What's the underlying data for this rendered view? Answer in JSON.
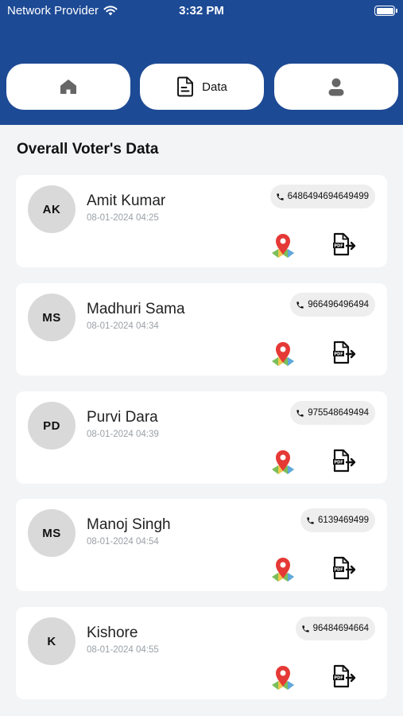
{
  "status_bar": {
    "carrier": "Network Provider",
    "time": "3:32 PM"
  },
  "tabs": [
    {
      "id": "home",
      "label": "",
      "icon": "home-icon"
    },
    {
      "id": "data",
      "label": "Data",
      "icon": "document-icon"
    },
    {
      "id": "profile",
      "label": "",
      "icon": "user-icon"
    }
  ],
  "section_title": "Overall Voter's Data",
  "voters": [
    {
      "initials": "AK",
      "name": "Amit Kumar",
      "datetime": "08-01-2024 04:25",
      "phone": "6486494694649499"
    },
    {
      "initials": "MS",
      "name": "Madhuri Sama",
      "datetime": "08-01-2024 04:34",
      "phone": "966496496494"
    },
    {
      "initials": "PD",
      "name": "Purvi Dara",
      "datetime": "08-01-2024 04:39",
      "phone": "975548649494"
    },
    {
      "initials": "MS",
      "name": "Manoj Singh",
      "datetime": "08-01-2024 04:54",
      "phone": "6139469499"
    },
    {
      "initials": "K",
      "name": "Kishore",
      "datetime": "08-01-2024 04:55",
      "phone": "96484694664"
    }
  ],
  "icons": {
    "phone": "phone-icon",
    "map": "map-pin-icon",
    "pdf": "pdf-export-icon"
  },
  "colors": {
    "header_bg": "#1d4a95",
    "page_bg": "#f3f4f6",
    "map_pin": "#e53935"
  }
}
